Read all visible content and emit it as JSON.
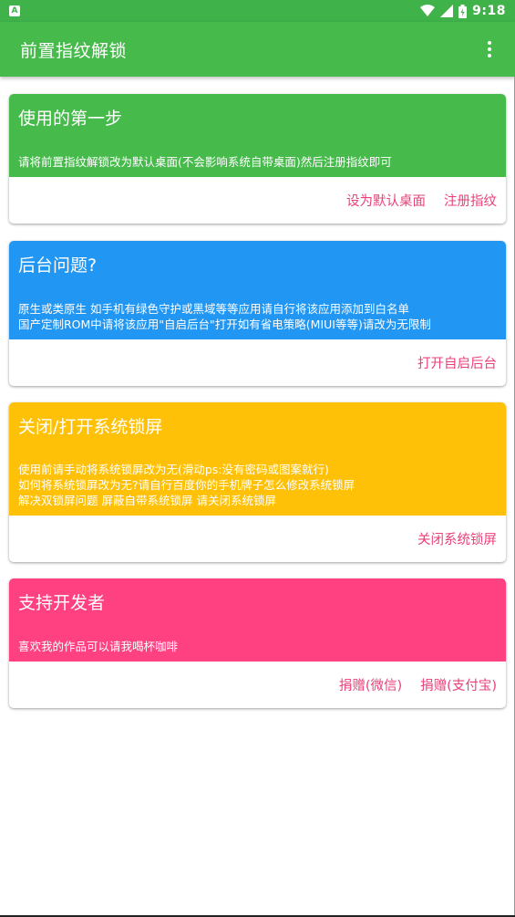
{
  "status_bar": {
    "notification_icon": "A",
    "time": "9:18",
    "icons": [
      "wifi-icon",
      "signal-icon",
      "battery-icon"
    ]
  },
  "app_bar": {
    "title": "前置指纹解锁",
    "menu_icon": "more-vert-icon"
  },
  "colors": {
    "green": "#46bb4b",
    "blue": "#2196f3",
    "amber": "#ffc107",
    "pink": "#ff4081",
    "accent_text": "#ea4079"
  },
  "cards": [
    {
      "title": "使用的第一步",
      "lines": [
        "请将前置指纹解锁改为默认桌面(不会影响系统自带桌面)然后注册指纹即可"
      ],
      "actions": [
        "设为默认桌面",
        "注册指纹"
      ]
    },
    {
      "title": "后台问题?",
      "lines": [
        "原生或类原生 如手机有绿色守护或黑域等等应用请自行将该应用添加到白名单",
        "国产定制ROM中请将该应用\"自启后台\"打开如有省电策略(MIUI等等)请改为无限制"
      ],
      "actions": [
        "打开自启后台"
      ]
    },
    {
      "title": "关闭/打开系统锁屏",
      "lines": [
        "使用前请手动将系统锁屏改为无(滑动ps:没有密码或图案就行)",
        "如何将系统锁屏改为无?请自行百度你的手机牌子怎么修改系统锁屏",
        "解决双锁屏问题 屏蔽自带系统锁屏 请关闭系统锁屏"
      ],
      "actions": [
        "关闭系统锁屏"
      ]
    },
    {
      "title": "支持开发者",
      "lines": [
        "喜欢我的作品可以请我喝杯咖啡"
      ],
      "actions": [
        "捐赠(微信)",
        "捐赠(支付宝)"
      ]
    }
  ]
}
